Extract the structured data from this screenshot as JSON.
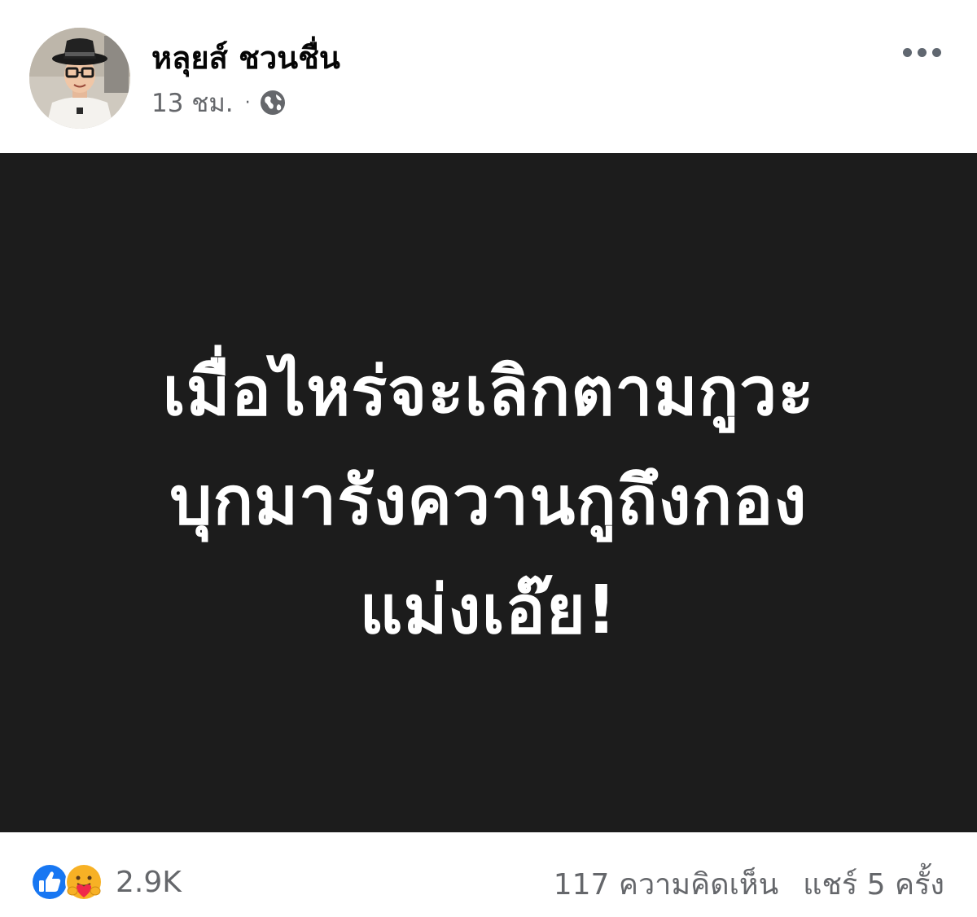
{
  "post": {
    "author": {
      "name": "หลุยส์ ชวนชื่น",
      "avatar_icon": "profile-photo-avatar"
    },
    "meta": {
      "time": "13 ชม.",
      "separator": "·",
      "privacy_icon": "globe-icon"
    },
    "more_icon": "more-options-icon",
    "card": {
      "background": "#1c1c1c",
      "text_color": "#ffffff",
      "lines": [
        "เมื่อไหร่จะเลิกตามกูวะ",
        "บุกมารังควานกูถึงกอง",
        "แม่งเอ๊ย!"
      ]
    },
    "footer": {
      "reaction_icons": [
        "like-icon",
        "care-icon"
      ],
      "reaction_count": "2.9K",
      "comments": "117 ความคิดเห็น",
      "shares": "แชร์ 5 ครั้ง"
    },
    "colors": {
      "like_blue": "#1877f2",
      "care_yellow": "#f7b125",
      "secondary_text": "#65676b"
    }
  }
}
